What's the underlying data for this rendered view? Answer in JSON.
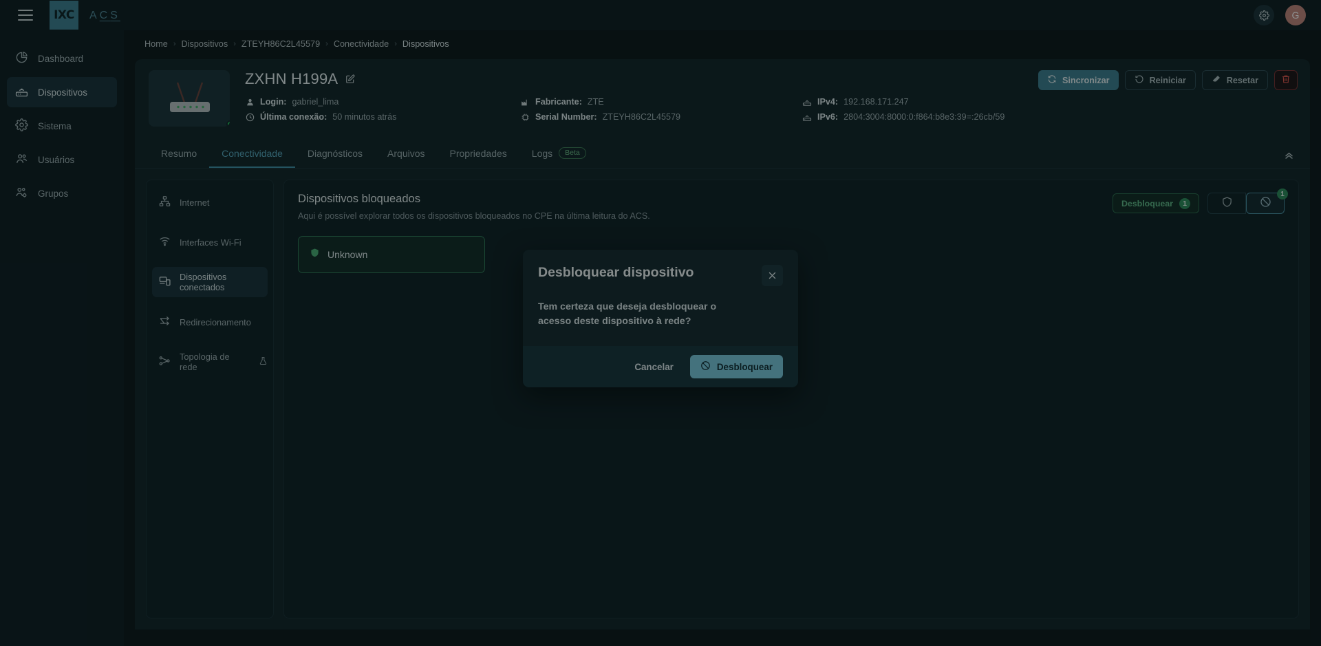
{
  "topbar": {
    "menu_icon": "hamburger-icon",
    "logo_badge": "IXC",
    "logo_text_a": "A",
    "logo_text_c": "C",
    "logo_text_s": "S",
    "settings_icon": "gear-icon",
    "avatar_initial": "G"
  },
  "sidebar": {
    "items": [
      {
        "label": "Dashboard",
        "icon": "pie-chart-icon",
        "active": false
      },
      {
        "label": "Dispositivos",
        "icon": "router-icon",
        "active": true
      },
      {
        "label": "Sistema",
        "icon": "gear-icon",
        "active": false
      },
      {
        "label": "Usuários",
        "icon": "users-icon",
        "active": false
      },
      {
        "label": "Grupos",
        "icon": "users-gear-icon",
        "active": false
      }
    ]
  },
  "breadcrumb": [
    "Home",
    "Dispositivos",
    "ZTEYH86C2L45579",
    "Conectividade",
    "Dispositivos"
  ],
  "device": {
    "title": "ZXHN H199A",
    "edit_icon": "edit-pencil-icon",
    "thumbnail_icon": "router-device-image",
    "status": "online",
    "meta": {
      "login_label": "Login:",
      "login_value": "gabriel_lima",
      "last_conn_label": "Última conexão:",
      "last_conn_value": "50 minutos atrás",
      "manufacturer_label": "Fabricante:",
      "manufacturer_value": "ZTE",
      "serial_label": "Serial Number:",
      "serial_value": "ZTEYH86C2L45579",
      "ipv4_label": "IPv4:",
      "ipv4_value": "192.168.171.247",
      "ipv6_label": "IPv6:",
      "ipv6_value": "2804:3004:8000:0:f864:b8e3:39=:26cb/59"
    },
    "actions": {
      "sync": "Sincronizar",
      "restart": "Reiniciar",
      "reset": "Resetar",
      "delete_icon": "trash-icon"
    }
  },
  "tabs": [
    {
      "label": "Resumo",
      "active": false
    },
    {
      "label": "Conectividade",
      "active": true
    },
    {
      "label": "Diagnósticos",
      "active": false
    },
    {
      "label": "Arquivos",
      "active": false
    },
    {
      "label": "Propriedades",
      "active": false
    },
    {
      "label": "Logs",
      "active": false,
      "badge": "Beta"
    }
  ],
  "collapse_icon": "chevron-up-icon",
  "subnav": {
    "items": [
      {
        "label": "Internet",
        "icon": "network-icon",
        "active": false
      },
      {
        "label": "Interfaces Wi-Fi",
        "icon": "wifi-icon",
        "active": false
      },
      {
        "label": "Dispositivos conectados",
        "icon": "devices-icon",
        "active": true
      },
      {
        "label": "Redirecionamento",
        "icon": "shuffle-icon",
        "active": false
      },
      {
        "label": "Topologia de rede",
        "icon": "topology-icon",
        "active": false,
        "flask": "flask-icon"
      }
    ]
  },
  "panel": {
    "title": "Dispositivos bloqueados",
    "subtitle": "Aqui é possível explorar todos os dispositivos bloqueados no CPE na última leitura do ACS.",
    "unblock_button": "Desbloquear",
    "unblock_count": "1",
    "shield_icon": "shield-icon",
    "blocked_icon": "circle-slash-icon",
    "blocked_count": "1",
    "cards": [
      {
        "name": "Unknown",
        "icon": "shield-check-icon"
      }
    ]
  },
  "modal": {
    "title": "Desbloquear dispositivo",
    "close_icon": "close-icon",
    "body": "Tem certeza que deseja desbloquear o acesso deste dispositivo à rede?",
    "cancel": "Cancelar",
    "confirm": "Desbloquear",
    "confirm_icon": "circle-slash-icon"
  },
  "colors": {
    "accent": "#3c7f91",
    "accent_light": "#79c6db",
    "success": "#2d8a5a",
    "danger": "#e2564c",
    "bg": "#0b1619",
    "panel": "#112327"
  }
}
